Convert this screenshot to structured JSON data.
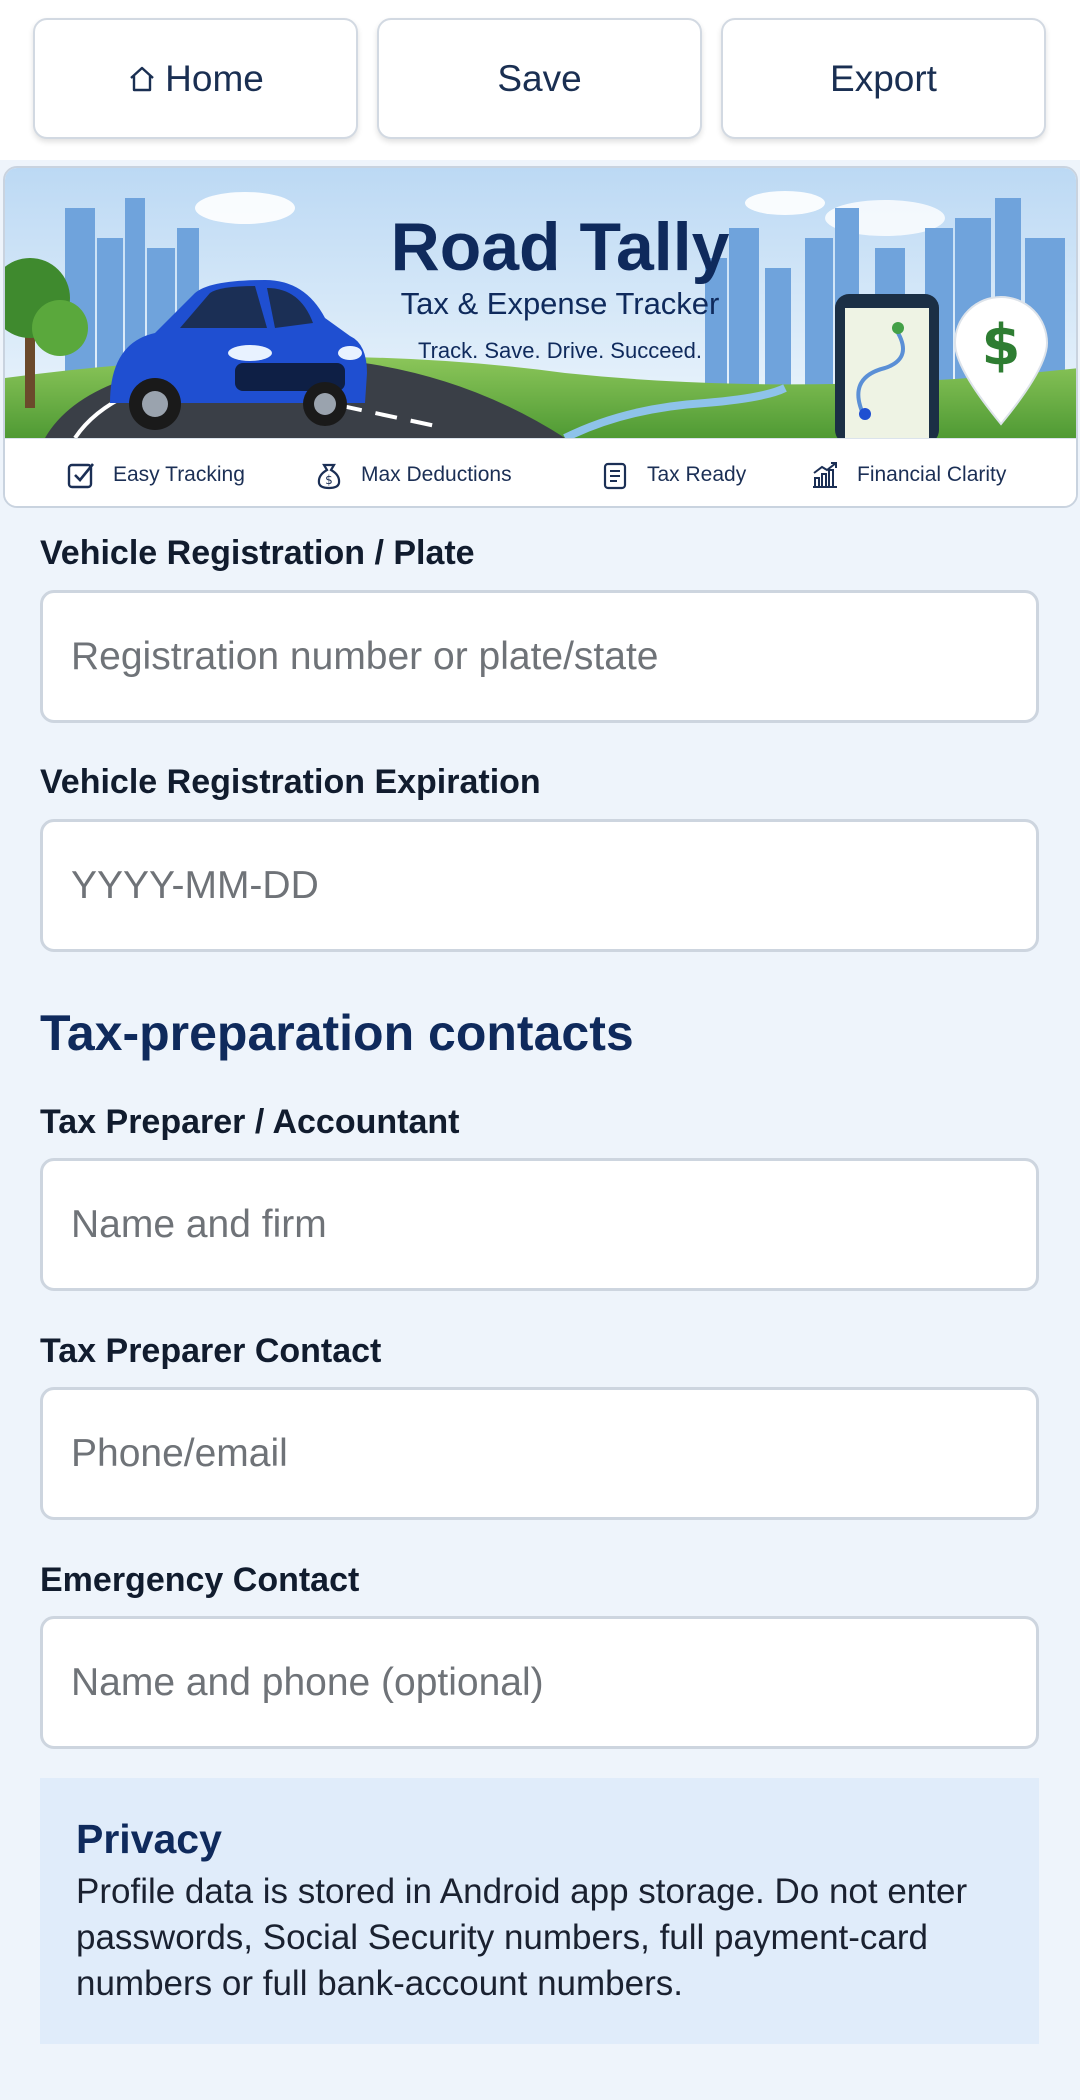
{
  "toolbar": {
    "home_label": "Home",
    "save_label": "Save",
    "export_label": "Export"
  },
  "banner": {
    "title": "Road Tally",
    "subtitle": "Tax & Expense Tracker",
    "tagline": "Track. Save. Drive. Succeed.",
    "dollar_sign": "$",
    "features": [
      {
        "label": "Easy Tracking",
        "icon": "checkbox-icon"
      },
      {
        "label": "Max Deductions",
        "icon": "money-bag-icon"
      },
      {
        "label": "Tax Ready",
        "icon": "clipboard-icon"
      },
      {
        "label": "Financial Clarity",
        "icon": "growth-chart-icon"
      }
    ]
  },
  "form": {
    "registration": {
      "label": "Vehicle Registration / Plate",
      "placeholder": "Registration number or plate/state",
      "value": ""
    },
    "expiration": {
      "label": "Vehicle Registration Expiration",
      "placeholder": "YYYY-MM-DD",
      "value": ""
    },
    "section_title": "Tax-preparation contacts",
    "preparer": {
      "label": "Tax Preparer / Accountant",
      "placeholder": "Name and firm",
      "value": ""
    },
    "preparer_contact": {
      "label": "Tax Preparer Contact",
      "placeholder": "Phone/email",
      "value": ""
    },
    "emergency": {
      "label": "Emergency Contact",
      "placeholder": "Name and phone (optional)",
      "value": ""
    }
  },
  "privacy": {
    "title": "Privacy",
    "text": "Profile data is stored in Android app storage. Do not enter passwords, Social Security numbers, full payment-card numbers or full bank-account numbers."
  },
  "colors": {
    "brand_navy": "#0f2a5c",
    "page_background": "#eef4fb",
    "privacy_background": "#e0ecfa",
    "car_blue": "#1f4fd1",
    "dollar_green": "#2e7d32"
  }
}
